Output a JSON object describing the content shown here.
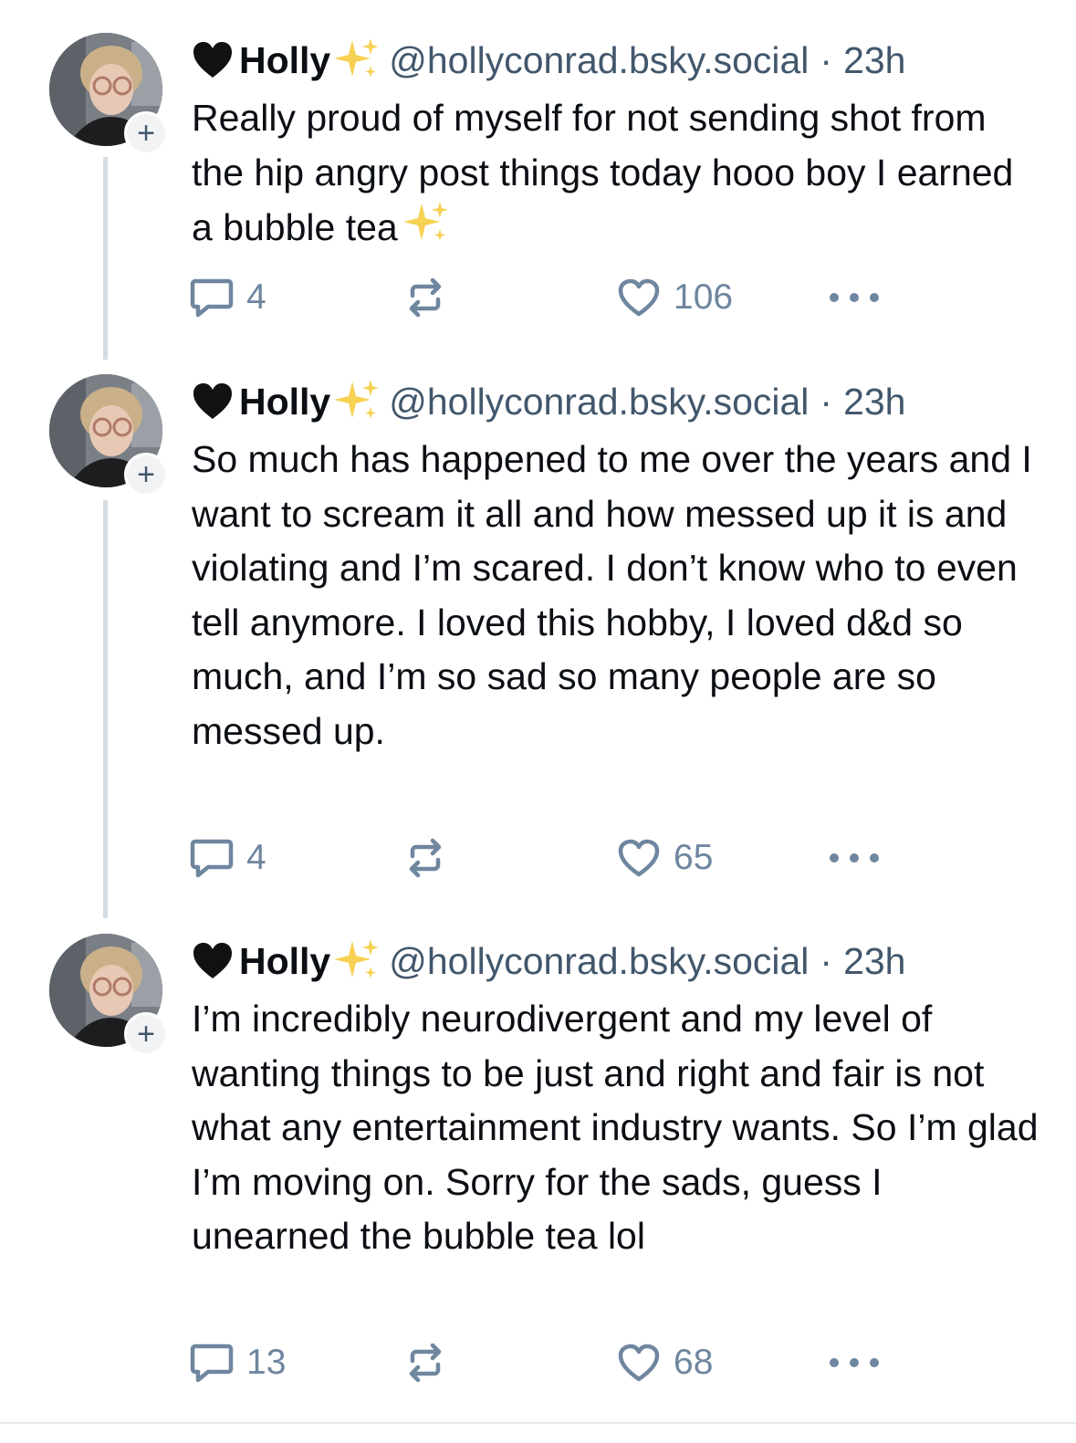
{
  "posts": [
    {
      "author": {
        "emoji_prefix": "🖤",
        "name": "Holly",
        "emoji_suffix": "✨",
        "handle": "@hollyconrad.bsky.social"
      },
      "separator": "·",
      "time": "23h",
      "text": "Really proud of myself for not sending shot from the hip angry post things today hooo boy I earned a bubble tea",
      "text_trailing_emoji": "✨",
      "replies": "4",
      "reposts": "",
      "likes": "106"
    },
    {
      "author": {
        "emoji_prefix": "🖤",
        "name": "Holly",
        "emoji_suffix": "✨",
        "handle": "@hollyconrad.bsky.social"
      },
      "separator": "·",
      "time": "23h",
      "text": "So much has happened to me over the years and I want to scream it all and how messed up it is and violating and I’m scared. I don’t know who to even tell anymore. I loved this hobby, I loved d&d so much, and I’m so sad so many people are so messed up.",
      "text_trailing_emoji": "",
      "replies": "4",
      "reposts": "",
      "likes": "65"
    },
    {
      "author": {
        "emoji_prefix": "🖤",
        "name": "Holly",
        "emoji_suffix": "✨",
        "handle": "@hollyconrad.bsky.social"
      },
      "separator": "·",
      "time": "23h",
      "text": "I’m incredibly neurodivergent and my level of wanting things to be just and right and fair is not what any entertainment industry wants. So I’m glad I’m moving on. Sorry for the sads, guess I unearned the bubble tea lol",
      "text_trailing_emoji": "",
      "replies": "13",
      "reposts": "",
      "likes": "68"
    }
  ],
  "colors": {
    "text": "#0b0f14",
    "muted": "#42576c",
    "icon": "#6f869f",
    "thread_line": "#d4dbe2",
    "sparkle": "#f7d154"
  },
  "icons": [
    "black-heart-emoji",
    "sparkles-emoji",
    "reply-icon",
    "repost-icon",
    "like-icon",
    "more-icon",
    "follow-plus-icon"
  ]
}
